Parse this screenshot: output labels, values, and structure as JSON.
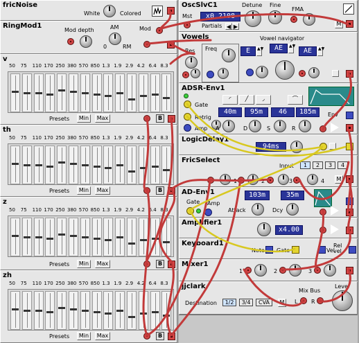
{
  "modules": {
    "fricnoise": {
      "title": "fricNoise",
      "white": "White",
      "colored": "Colored"
    },
    "ringmod": {
      "title": "RingMod1",
      "mod_depth": "Mod depth",
      "am": "AM",
      "zero": "0",
      "rm": "RM",
      "mod": "Mod"
    },
    "oscslv": {
      "title": "OscSlvC1",
      "mst": "Mst",
      "partials": "Partials",
      "value": "x0.2108",
      "detune": "Detune",
      "fine": "Fine",
      "fma": "FMA",
      "m": "M"
    },
    "vowels": {
      "title": "Vowels",
      "res": "Res",
      "freq": "Freq",
      "navigator": "Vowel navigator",
      "vowel_a": "E",
      "vowel_b": "AE",
      "vowel_c": "AE"
    },
    "eq_v": {
      "title": "v"
    },
    "eq_th": {
      "title": "th"
    },
    "eq_z": {
      "title": "z"
    },
    "eq_zh": {
      "title": "zh"
    },
    "eq_common": {
      "presets": "Presets",
      "min": "Min",
      "max": "Max",
      "b": "B"
    },
    "adsr": {
      "title": "ADSR-Env1",
      "gate": "Gate",
      "retrig": "Retrig",
      "amp": "Amp",
      "a": "A",
      "d": "D",
      "s": "S",
      "r": "R",
      "env": "Env",
      "lcd_a": "40m",
      "lcd_d": "95m",
      "lcd_s": "46",
      "lcd_r": "185m"
    },
    "logicdelay": {
      "title": "LogicDelay1",
      "value": "94ms"
    },
    "fricselect": {
      "title": "FricSelect",
      "input": "Input",
      "tabs": [
        "1",
        "2",
        "3",
        "4"
      ],
      "ports": [
        "1",
        "2",
        "3",
        "4"
      ],
      "m": "M"
    },
    "adenv": {
      "title": "AD-Env1",
      "gate": "Gate",
      "amp": "Amp",
      "attack": "Attack",
      "dcy": "Dcy",
      "lcd_attack": "103m",
      "lcd_dcy": "35m"
    },
    "amplifier": {
      "title": "Amplifier1",
      "value": "x4.00"
    },
    "keyboard": {
      "title": "Keyboard1",
      "note": "Note",
      "gate": "Gate",
      "vel": "Vel",
      "relvel": "Rel vel"
    },
    "mixer": {
      "title": "Mixer1",
      "ports": [
        "1",
        "2",
        "3"
      ]
    },
    "jjclark": {
      "title": "jjclark",
      "destination": "Destination",
      "dest_opts": [
        "1/2",
        "3/4",
        "CVA"
      ],
      "m": "M",
      "mixbus": "Mix Bus",
      "level": "Level",
      "l": "L",
      "r": "R"
    }
  },
  "eq_freqs": [
    "50",
    "75",
    "110",
    "170",
    "250",
    "380",
    "570",
    "850",
    "1.3",
    "1.9",
    "2.9",
    "4.2",
    "6.4",
    "8.3"
  ],
  "colors": {
    "cable_red": "#c23a3a",
    "cable_yellow": "#d8c820",
    "lcd": "#2a3498",
    "panel": "#e6e6e6"
  }
}
